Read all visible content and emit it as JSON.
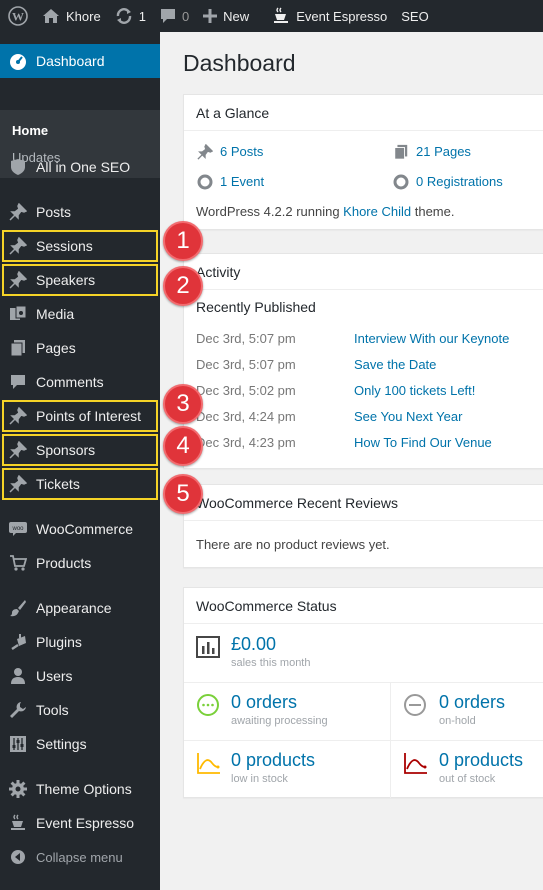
{
  "adminbar": {
    "site_name": "Khore",
    "updates_count": "1",
    "comments_count": "0",
    "new_label": "New",
    "event_espresso": "Event Espresso",
    "seo": "SEO"
  },
  "sidebar": {
    "dashboard": "Dashboard",
    "home": "Home",
    "updates": "Updates",
    "aioseo": "All in One SEO",
    "posts": "Posts",
    "sessions": "Sessions",
    "speakers": "Speakers",
    "media": "Media",
    "pages": "Pages",
    "comments": "Comments",
    "points_of_interest": "Points of Interest",
    "sponsors": "Sponsors",
    "tickets": "Tickets",
    "woocommerce": "WooCommerce",
    "products": "Products",
    "appearance": "Appearance",
    "plugins": "Plugins",
    "users": "Users",
    "tools": "Tools",
    "settings": "Settings",
    "theme_options": "Theme Options",
    "event_espresso": "Event Espresso",
    "collapse": "Collapse menu"
  },
  "badges": [
    "1",
    "2",
    "3",
    "4",
    "5"
  ],
  "main": {
    "title": "Dashboard",
    "glance": {
      "title": "At a Glance",
      "posts": "6 Posts",
      "pages": "21 Pages",
      "event": "1 Event",
      "registrations": "0 Registrations",
      "footer_pre": "WordPress 4.2.2 running ",
      "theme_link": "Khore Child",
      "footer_post": " theme."
    },
    "activity": {
      "title": "Activity",
      "recent": "Recently Published",
      "rows": [
        {
          "date": "Dec 3rd, 5:07 pm",
          "title": "Interview With our Keynote"
        },
        {
          "date": "Dec 3rd, 5:07 pm",
          "title": "Save the Date"
        },
        {
          "date": "Dec 3rd, 5:02 pm",
          "title": "Only 100 tickets Left!"
        },
        {
          "date": "Dec 3rd, 4:24 pm",
          "title": "See You Next Year"
        },
        {
          "date": "Dec 3rd, 4:23 pm",
          "title": "How To Find Our Venue"
        }
      ]
    },
    "reviews": {
      "title": "WooCommerce Recent Reviews",
      "empty": "There are no product reviews yet."
    },
    "status": {
      "title": "WooCommerce Status",
      "sales_value": "£0.00",
      "sales_label": "sales this month",
      "orders_processing": "0 orders",
      "orders_processing_label": "awaiting processing",
      "orders_hold": "0 orders",
      "orders_hold_label": "on-hold",
      "low_stock": "0 products",
      "low_stock_label": "low in stock",
      "out_stock": "0 products",
      "out_stock_label": "out of stock"
    }
  },
  "colors": {
    "menu_bg": "#23282d",
    "accent": "#0073aa",
    "highlight": "#f5d327",
    "badge": "#e0343a"
  }
}
